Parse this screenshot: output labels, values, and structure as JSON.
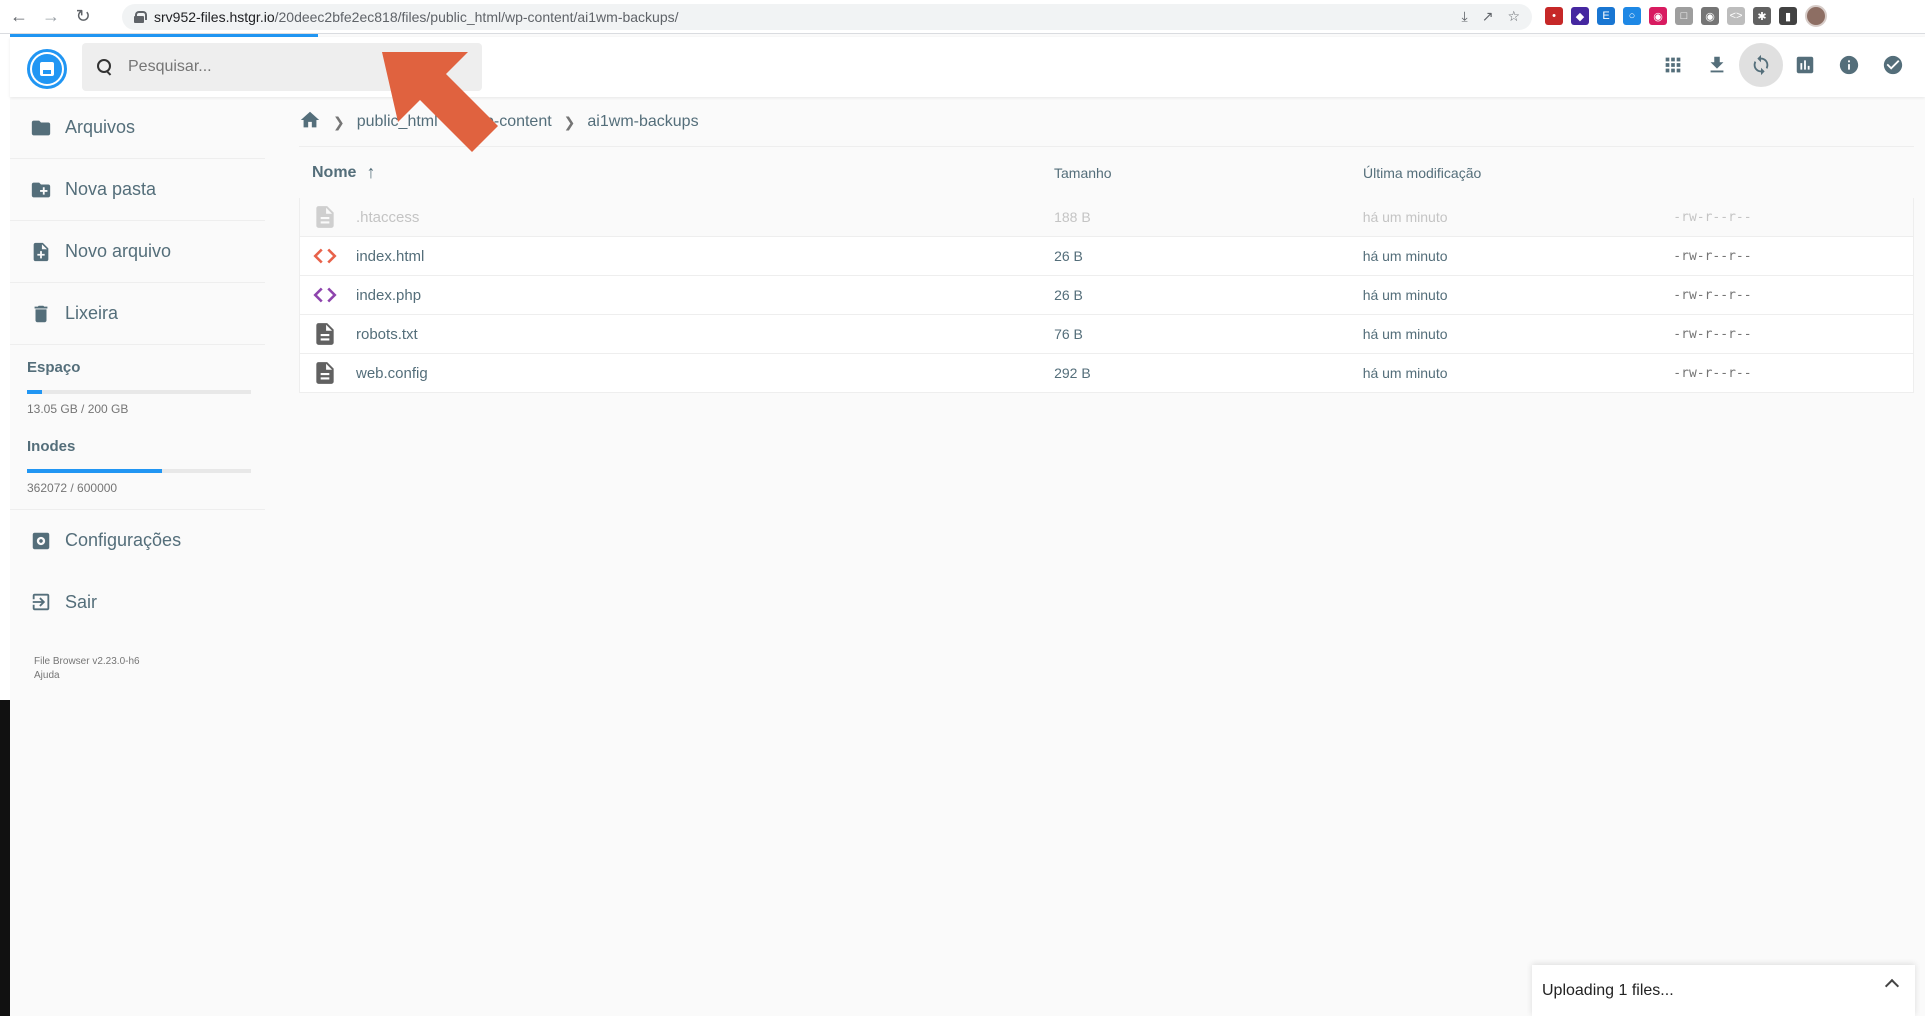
{
  "browser": {
    "url_domain": "srv952-files.hstgr.io",
    "url_path": "/20deec2bfe2ec818/files/public_html/wp-content/ai1wm-backups/"
  },
  "header": {
    "search_placeholder": "Pesquisar...",
    "actions": [
      "grid-view-icon",
      "download-icon",
      "refresh-icon",
      "stats-icon",
      "info-icon",
      "check-icon"
    ]
  },
  "sidebar": {
    "items": [
      {
        "label": "Arquivos",
        "icon": "folder-icon"
      },
      {
        "label": "Nova pasta",
        "icon": "new-folder-icon"
      },
      {
        "label": "Novo arquivo",
        "icon": "new-file-icon"
      },
      {
        "label": "Lixeira",
        "icon": "trash-icon"
      }
    ],
    "space": {
      "title": "Espaço",
      "text": "13.05 GB / 200 GB",
      "fraction": 0.065
    },
    "inodes": {
      "title": "Inodes",
      "text": "362072 / 600000",
      "fraction": 0.603
    },
    "bottom_items": [
      {
        "label": "Configurações",
        "icon": "settings-icon"
      },
      {
        "label": "Sair",
        "icon": "logout-icon"
      }
    ],
    "version": "File Browser v2.23.0-h6",
    "help": "Ajuda"
  },
  "breadcrumbs": [
    "public_html",
    "wp-content",
    "ai1wm-backups"
  ],
  "listing": {
    "headers": {
      "name": "Nome",
      "size": "Tamanho",
      "modified": "Última modificação"
    },
    "rows": [
      {
        "name": ".htaccess",
        "size": "188 B",
        "modified": "há um minuto",
        "perms": "-rw-r--r--",
        "type": "text",
        "hidden": true
      },
      {
        "name": "index.html",
        "size": "26 B",
        "modified": "há um minuto",
        "perms": "-rw-r--r--",
        "type": "html",
        "hidden": false
      },
      {
        "name": "index.php",
        "size": "26 B",
        "modified": "há um minuto",
        "perms": "-rw-r--r--",
        "type": "php",
        "hidden": false
      },
      {
        "name": "robots.txt",
        "size": "76 B",
        "modified": "há um minuto",
        "perms": "-rw-r--r--",
        "type": "text",
        "hidden": false
      },
      {
        "name": "web.config",
        "size": "292 B",
        "modified": "há um minuto",
        "perms": "-rw-r--r--",
        "type": "text",
        "hidden": false
      }
    ]
  },
  "upload": {
    "text": "Uploading 1 files..."
  },
  "colors": {
    "accent": "#2196f3",
    "sidebar_text": "#546e7a",
    "html_icon": "#e8624a",
    "php_icon": "#8e44ad",
    "annotation": "#e0623f"
  }
}
